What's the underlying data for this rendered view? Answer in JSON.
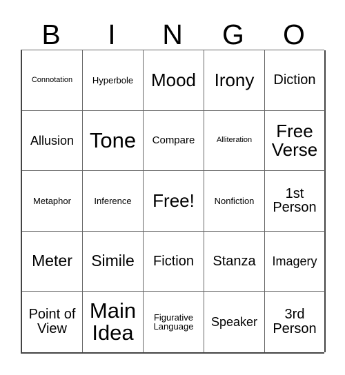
{
  "card": {
    "title_letters": [
      "B",
      "I",
      "N",
      "G",
      "O"
    ],
    "columns": 5,
    "rows": 5,
    "colors": {
      "background": "#ffffff",
      "text": "#000000",
      "grid_line": "#666666",
      "grid_border": "#444444"
    },
    "free_space": {
      "label": "Free!",
      "row": 3,
      "column": 3
    },
    "grid": [
      [
        {
          "label": "Connotation",
          "size": "xs"
        },
        {
          "label": "Hyperbole",
          "size": "sm"
        },
        {
          "label": "Mood",
          "size": "3xl"
        },
        {
          "label": "Irony",
          "size": "3xl"
        },
        {
          "label": "Diction",
          "size": "xl"
        }
      ],
      [
        {
          "label": "Allusion",
          "size": "lg"
        },
        {
          "label": "Tone",
          "size": "4xl"
        },
        {
          "label": "Compare",
          "size": "md"
        },
        {
          "label": "Alliteration",
          "size": "xs"
        },
        {
          "label": "Free Verse",
          "size": "3xl"
        }
      ],
      [
        {
          "label": "Metaphor",
          "size": "sm"
        },
        {
          "label": "Inference",
          "size": "sm"
        },
        {
          "label": "Free!",
          "size": "3xl"
        },
        {
          "label": "Nonfiction",
          "size": "sm"
        },
        {
          "label": "1st Person",
          "size": "xl"
        }
      ],
      [
        {
          "label": "Meter",
          "size": "2xl"
        },
        {
          "label": "Simile",
          "size": "2xl"
        },
        {
          "label": "Fiction",
          "size": "xl"
        },
        {
          "label": "Stanza",
          "size": "xl"
        },
        {
          "label": "Imagery",
          "size": "lg"
        }
      ],
      [
        {
          "label": "Point of View",
          "size": "xl"
        },
        {
          "label": "Main Idea",
          "size": "4xl"
        },
        {
          "label": "Figurative Language",
          "size": "sm"
        },
        {
          "label": "Speaker",
          "size": "lg"
        },
        {
          "label": "3rd Person",
          "size": "xl"
        }
      ]
    ]
  }
}
